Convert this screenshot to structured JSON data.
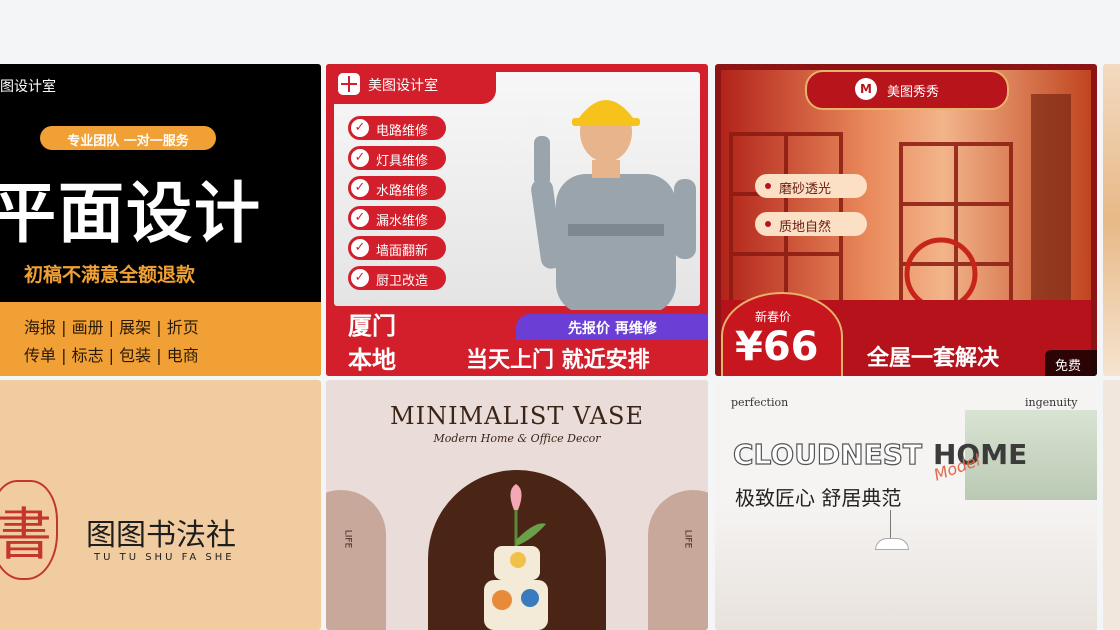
{
  "cards": {
    "c1": {
      "brand": "图设计室",
      "pill": "专业团队 一对一服务",
      "title": "平面设计",
      "subtitle": "初稿不满意全额退款",
      "row1": [
        "海报",
        "画册",
        "展架",
        "折页"
      ],
      "row2": [
        "传单",
        "标志",
        "包装",
        "电商"
      ]
    },
    "c2": {
      "brand": "美图设计室",
      "services": [
        "电路维修",
        "灯具维修",
        "水路维修",
        "漏水维修",
        "墙面翻新",
        "厨卫改造"
      ],
      "badge": "先报价 再维修",
      "city_line1": "厦门",
      "city_line2": "本地",
      "slogan": "当天上门 就近安排"
    },
    "c3": {
      "brand": "美图秀秀",
      "feature1": "磨砂透光",
      "feature2": "质地自然",
      "price_label": "新春价",
      "price": "¥66",
      "slogan": "全屋一套解决",
      "free_tag": "免费"
    },
    "c5": {
      "seal_char": "書",
      "name": "图图书法社",
      "pinyin": "TU TU SHU FA SHE"
    },
    "c6": {
      "title": "MINIMALIST VASE",
      "subtitle": "Modern Home & Office Decor",
      "side_left": "LIFE",
      "side_right": "LIFE"
    },
    "c7": {
      "tag_left": "perfection",
      "tag_right": "ingenuity",
      "title_a": "CLOUDNEST",
      "title_b": "HOME",
      "script": "Model",
      "slogan": "极致匠心 舒居典范"
    }
  },
  "colors": {
    "red": "#d21f2b",
    "orange": "#f0a034",
    "dark_red": "#8c1414",
    "brown": "#4a2415"
  }
}
